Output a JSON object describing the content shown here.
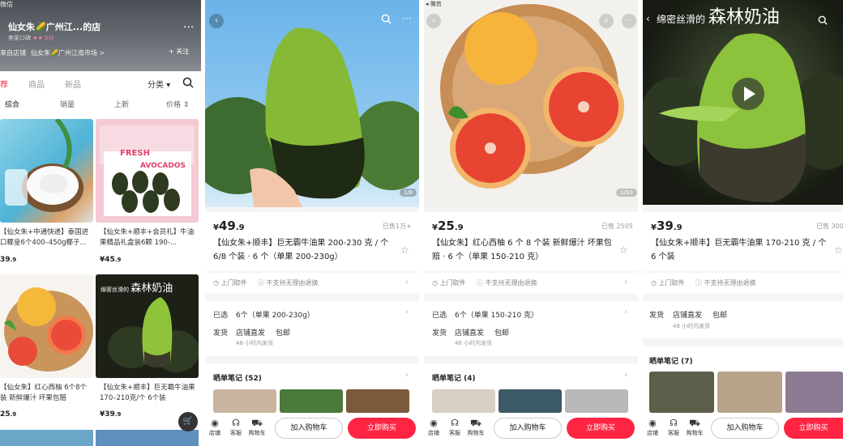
{
  "shop": {
    "status": "微信",
    "name": "仙女朱🌽广州江...的店",
    "sub_label": "卖家口碑",
    "sub_rating": "★★ 5分",
    "more": "···",
    "source_label": "来自店铺",
    "source_name": "仙女朱🌽广州江南市场 >",
    "follow": "+ 关注",
    "tabs": [
      "荐",
      "商品",
      "新品"
    ],
    "category": "分类 ▾",
    "search_icon": "search-icon",
    "sort": [
      "综合",
      "销量",
      "上新",
      "价格 ⇕"
    ],
    "products": [
      {
        "title": "【仙女朱+中通快递】泰国进口椰皇6个400–450g椰子...",
        "price_int": "39",
        "price_dec": ".9"
      },
      {
        "title": "【仙女朱+顺丰+会员礼】牛油果精品礼盒装6颗 190-...",
        "price_int": "¥45",
        "price_dec": ".9"
      },
      {
        "title": "【仙女朱】红心西柚 6个8个装 新鲜爆汁 坏果包赔",
        "price_int": "25",
        "price_dec": ".9"
      },
      {
        "title": "【仙女朱+顺丰】巨无霸牛油果170–210克/个  6个装",
        "price_int": "¥39",
        "price_dec": ".9"
      }
    ],
    "box_text": [
      "FRESH",
      "AVOCADOS"
    ],
    "banner_text": "绵密丝滑的 森林奶油"
  },
  "detail1": {
    "status": "",
    "image_counter": "1/8",
    "price_int": "49",
    "price_dec": ".9",
    "sold": "已售1万+",
    "title": "【仙女朱+顺丰】巨无霸牛油果 200-230 克 / 个 6/8 个装 · 6 个（单果 200-230g）",
    "svc1": "上门取件",
    "svc2": "不支持无理由退换",
    "selected_label": "已选",
    "selected_value": "6个（单果 200-230g）",
    "ship_label": "发货",
    "ship_value": "店铺直发",
    "ship_free": "包邮",
    "ship_time": "48 小时内发货",
    "notes": "晒单笔记 (52)"
  },
  "detail2": {
    "status": "◂ 微信",
    "image_counter": "1/10",
    "price_int": "25",
    "price_dec": ".9",
    "sold": "已售 2505",
    "title": "【仙女朱】红心西柚 6 个 8 个装 新鲜爆汁 坏果包赔 · 6 个（单果 150-210 克）",
    "svc1": "上门取件",
    "svc2": "不支持无理由退换",
    "selected_label": "已选",
    "selected_value": "6个（单果 150-210 克）",
    "ship_label": "发货",
    "ship_value": "店铺直发",
    "ship_free": "包邮",
    "ship_time": "48 小时内发货",
    "notes": "晒单笔记 (4)"
  },
  "detail3": {
    "banner_light": "绵密丝滑的",
    "banner_bold": "森林奶油",
    "price_int": "39",
    "price_dec": ".9",
    "sold": "已售 300",
    "title": "【仙女朱+顺丰】巨无霸牛油果 170-210 克 / 个 6 个装",
    "svc1": "上门取件",
    "svc2": "不支持无理由退换",
    "ship_label": "发货",
    "ship_value": "店铺直发",
    "ship_free": "包邮",
    "ship_time": "48 小时内发货",
    "notes": "晒单笔记 (7)"
  },
  "bottom": {
    "shop": "店铺",
    "service": "客服",
    "cart": "购物车",
    "add_cart": "加入购物车",
    "buy_now": "立即购买"
  },
  "colors": {
    "accent": "#ff2442"
  }
}
